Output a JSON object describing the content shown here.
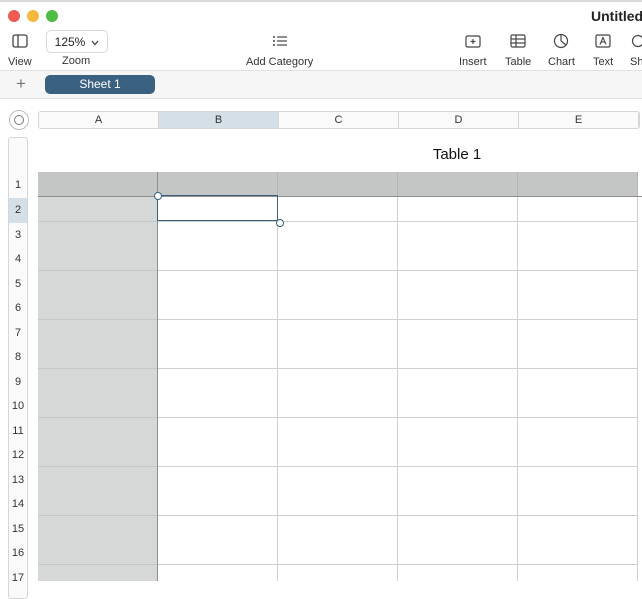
{
  "window": {
    "title": "Untitled"
  },
  "toolbar": {
    "view_label": "View",
    "zoom_value": "125%",
    "zoom_label": "Zoom",
    "add_category_label": "Add Category",
    "insert_label": "Insert",
    "table_label": "Table",
    "chart_label": "Chart",
    "text_label": "Text",
    "shape_label": "Sh"
  },
  "sheets": {
    "add_label": "+",
    "active": "Sheet 1"
  },
  "table": {
    "title": "Table 1",
    "columns": [
      "A",
      "B",
      "C",
      "D",
      "E"
    ],
    "rows": [
      "1",
      "2",
      "3",
      "4",
      "5",
      "6",
      "7",
      "8",
      "9",
      "10",
      "11",
      "12",
      "13",
      "14",
      "15",
      "16",
      "17"
    ],
    "selected_cell": "B2",
    "selected_column": "B",
    "selected_row": "2",
    "cells": []
  }
}
